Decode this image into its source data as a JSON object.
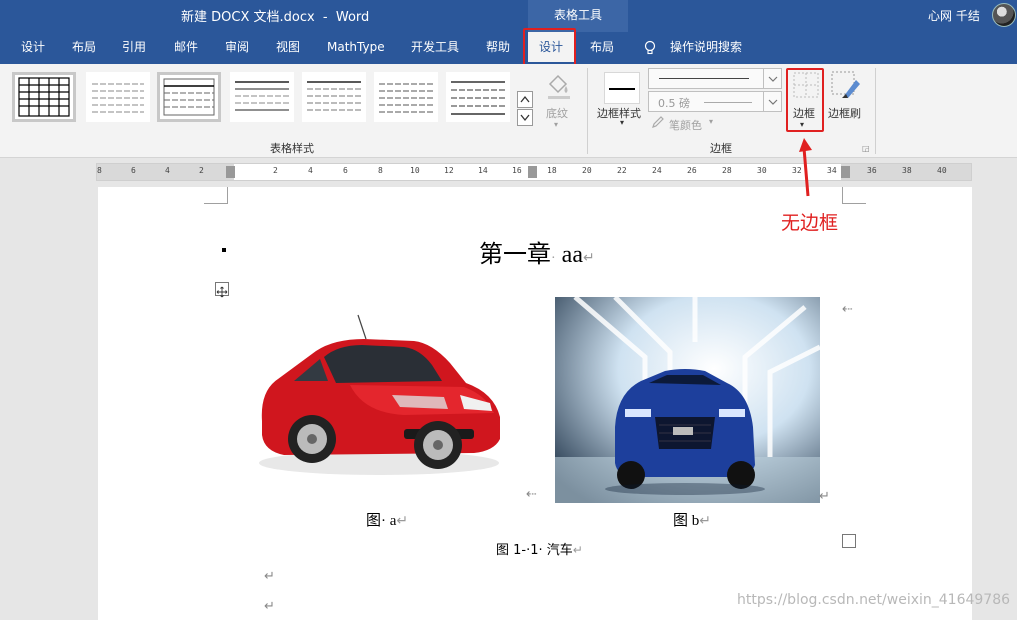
{
  "window": {
    "title": "新建 DOCX 文档.docx  -  Word",
    "context_tab": "表格工具",
    "user": "心网 千结"
  },
  "tabs": [
    "设计",
    "布局",
    "引用",
    "邮件",
    "审阅",
    "视图",
    "MathType",
    "开发工具",
    "帮助",
    "设计",
    "布局",
    "操作说明搜索"
  ],
  "ribbon": {
    "table_styles_group": "表格样式",
    "shading_label": "底纹",
    "border_style_label": "边框样式",
    "pen_weight": "0.5 磅",
    "pen_color": "笔颜色",
    "borders_label": "边框",
    "border_painter_label": "边框刷",
    "borders_group": "边框"
  },
  "ruler": {
    "labels": [
      "8",
      "6",
      "4",
      "2",
      "2",
      "4",
      "6",
      "8",
      "10",
      "12",
      "14",
      "16",
      "18",
      "20",
      "22",
      "24",
      "26",
      "28",
      "30",
      "32",
      "34",
      "36",
      "38",
      "40"
    ]
  },
  "document": {
    "heading_main": "第一章",
    "heading_suffix": "aa",
    "caption_a": "图· a",
    "caption_b": "图 b",
    "figure_caption": "图 1-·1· 汽车"
  },
  "annotation": {
    "text": "无边框",
    "color": "#e02020"
  },
  "watermark": "https://blog.csdn.net/weixin_41649786",
  "colors": {
    "word_blue": "#2b579a",
    "ribbon_bg": "#f3f3f3",
    "highlight_red": "#e02020"
  },
  "icons": {
    "shading": "paint-bucket-icon",
    "borders": "borders-grid-icon",
    "border_painter": "border-brush-icon",
    "tell_me": "lightbulb-icon",
    "table_move": "move-handle-icon"
  }
}
